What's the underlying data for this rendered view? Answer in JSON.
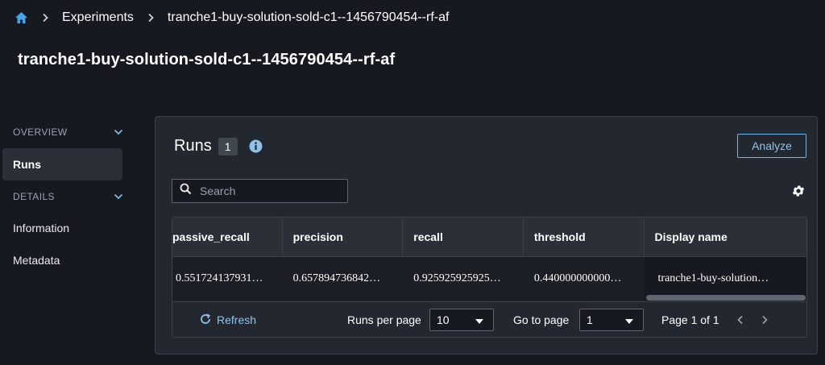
{
  "breadcrumb": {
    "experiments": "Experiments",
    "current": "tranche1-buy-solution-sold-c1--1456790454--rf-af"
  },
  "page_title": "tranche1-buy-solution-sold-c1--1456790454--rf-af",
  "sidebar": {
    "overview_label": "OVERVIEW",
    "runs_label": "Runs",
    "details_label": "DETAILS",
    "information_label": "Information",
    "metadata_label": "Metadata"
  },
  "runs": {
    "title": "Runs",
    "count": "1",
    "analyze_label": "Analyze",
    "search_placeholder": "Search"
  },
  "table": {
    "columns": [
      "passive_recall",
      "precision",
      "recall",
      "threshold",
      "Display name"
    ],
    "rows": [
      [
        "0.551724137931…",
        "0.657894736842…",
        "0.925925925925…",
        "0.440000000000…",
        "tranche1-buy-solution…"
      ]
    ]
  },
  "footer": {
    "refresh_label": "Refresh",
    "runs_per_page_label": "Runs per page",
    "runs_per_page_value": "10",
    "go_to_page_label": "Go to page",
    "go_to_page_value": "1",
    "page_of": "Page 1 of 1"
  },
  "colors": {
    "background": "#16191f",
    "panel": "#232830",
    "accent": "#8fc3ea",
    "home_icon": "#4aa3e8"
  },
  "icons": [
    "home-icon",
    "chevron-right-icon",
    "chevron-down-icon",
    "info-icon",
    "search-icon",
    "gear-icon",
    "refresh-icon",
    "caret-down-icon",
    "chevron-left-icon"
  ]
}
